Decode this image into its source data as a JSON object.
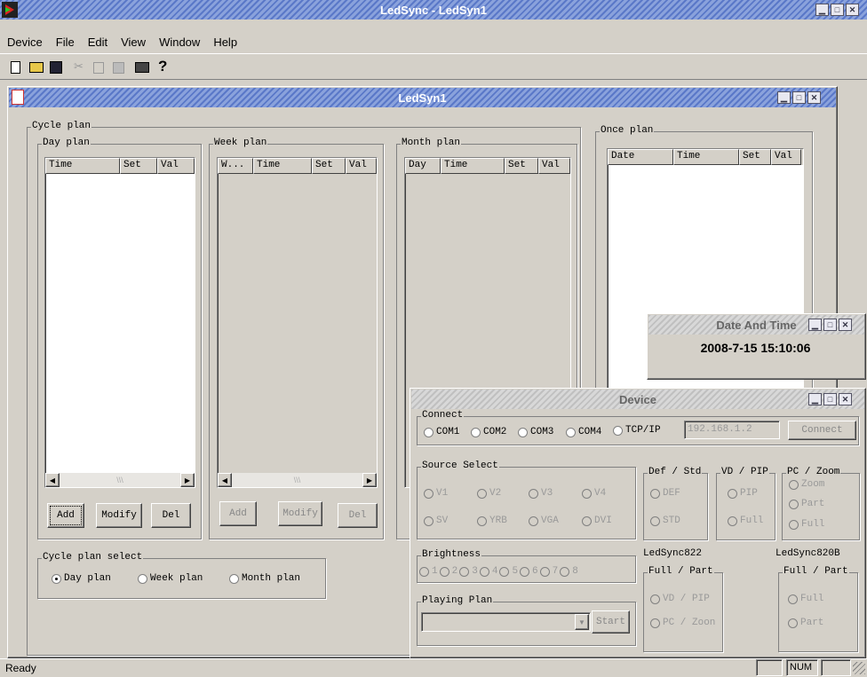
{
  "app": {
    "title": "LedSync - LedSyn1"
  },
  "menu": [
    "Device",
    "File",
    "Edit",
    "View",
    "Window",
    "Help"
  ],
  "child": {
    "title": "LedSyn1"
  },
  "cycle": {
    "group": "Cycle plan",
    "day": {
      "group": "Day plan",
      "cols": [
        "Time",
        "Set",
        "Val"
      ]
    },
    "week": {
      "group": "Week plan",
      "cols": [
        "W...",
        "Time",
        "Set",
        "Val"
      ]
    },
    "month": {
      "group": "Month plan",
      "cols": [
        "Day",
        "Time",
        "Set",
        "Val"
      ]
    },
    "buttons": {
      "add": "Add",
      "modify": "Modify",
      "del": "Del"
    },
    "select": {
      "group": "Cycle plan select",
      "options": [
        "Day plan",
        "Week plan",
        "Month plan"
      ],
      "selected": "Day plan"
    }
  },
  "once": {
    "group": "Once plan",
    "cols": [
      "Date",
      "Time",
      "Set",
      "Val"
    ]
  },
  "datetime": {
    "title": "Date And Time",
    "value": "2008-7-15 15:10:06"
  },
  "device": {
    "title": "Device",
    "connect": {
      "group": "Connect",
      "ports": [
        "COM1",
        "COM2",
        "COM3",
        "COM4",
        "TCP/IP"
      ],
      "ip": "192.168.1.2",
      "button": "Connect"
    },
    "source": {
      "group": "Source Select",
      "row1": [
        "V1",
        "V2",
        "V3",
        "V4"
      ],
      "row2": [
        "SV",
        "YRB",
        "VGA",
        "DVI"
      ]
    },
    "defstd": {
      "group": "Def / Std",
      "options": [
        "DEF",
        "STD"
      ]
    },
    "vdpip": {
      "group": "VD / PIP",
      "options": [
        "PIP",
        "Full"
      ]
    },
    "pczoom": {
      "group": "PC / Zoom",
      "options": [
        "Zoom",
        "Part",
        "Full"
      ]
    },
    "brightness": {
      "group": "Brightness",
      "levels": [
        "1",
        "2",
        "3",
        "4",
        "5",
        "6",
        "7",
        "8"
      ]
    },
    "playing": {
      "group": "Playing Plan",
      "start": "Start"
    },
    "led822": {
      "label": "LedSync822",
      "group": "Full / Part",
      "options": [
        "VD / PIP",
        "PC / Zoon"
      ]
    },
    "led820b": {
      "label": "LedSync820B",
      "group": "Full / Part",
      "options": [
        "Full",
        "Part"
      ]
    }
  },
  "status": {
    "text": "Ready",
    "num": "NUM"
  }
}
